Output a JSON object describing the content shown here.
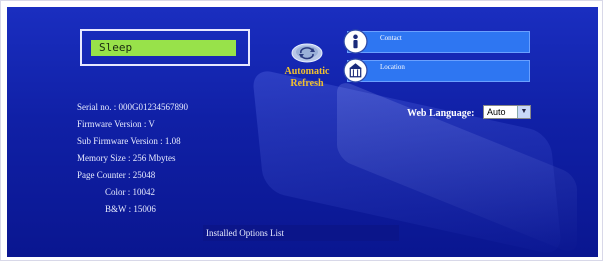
{
  "status": {
    "lcd_text": "Sleep"
  },
  "refresh": {
    "label": "Automatic\nRefresh",
    "icon": "refresh-globe-icon"
  },
  "links": {
    "contact_label": "Contact",
    "location_label": "Location"
  },
  "language": {
    "label": "Web Language:",
    "selected": "Auto"
  },
  "device_info": {
    "serial": "Serial no. : 000G01234567890",
    "firmware": "Firmware Version : V",
    "sub_firmware": "Sub Firmware Version : 1.08",
    "memory": "Memory Size : 256 Mbytes",
    "page_counter": "Page Counter : 25048",
    "color": "Color : 10042",
    "bw": "B&W : 15006"
  },
  "options": {
    "label": "Installed Options List"
  },
  "colors": {
    "background": "#1424b0",
    "lcd": "#98e24a",
    "link_button": "#2e76f2",
    "refresh_text": "#f0c030"
  }
}
